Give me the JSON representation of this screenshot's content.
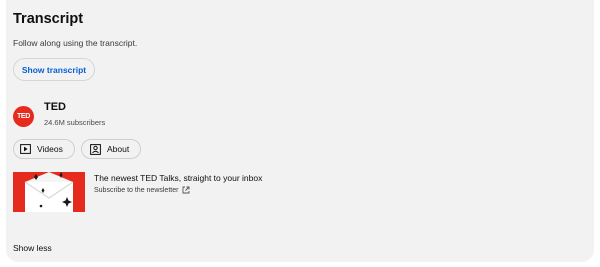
{
  "transcript": {
    "title": "Transcript",
    "description": "Follow along using the transcript.",
    "button_label": "Show transcript"
  },
  "channel": {
    "avatar_text": "TED",
    "name": "TED",
    "subscribers": "24.6M subscribers",
    "brand_color": "#e62b1e"
  },
  "chips": [
    {
      "label": "Videos",
      "icon": "play-icon"
    },
    {
      "label": "About",
      "icon": "profile-icon"
    }
  ],
  "newsletter": {
    "title": "The newest TED Talks, straight to your inbox",
    "link_label": "Subscribe to the newsletter",
    "link_icon": "external-link-icon"
  },
  "footer": {
    "show_less_label": "Show less"
  },
  "colors": {
    "panel_bg": "#f2f2f2",
    "link_blue": "#065fd4"
  }
}
